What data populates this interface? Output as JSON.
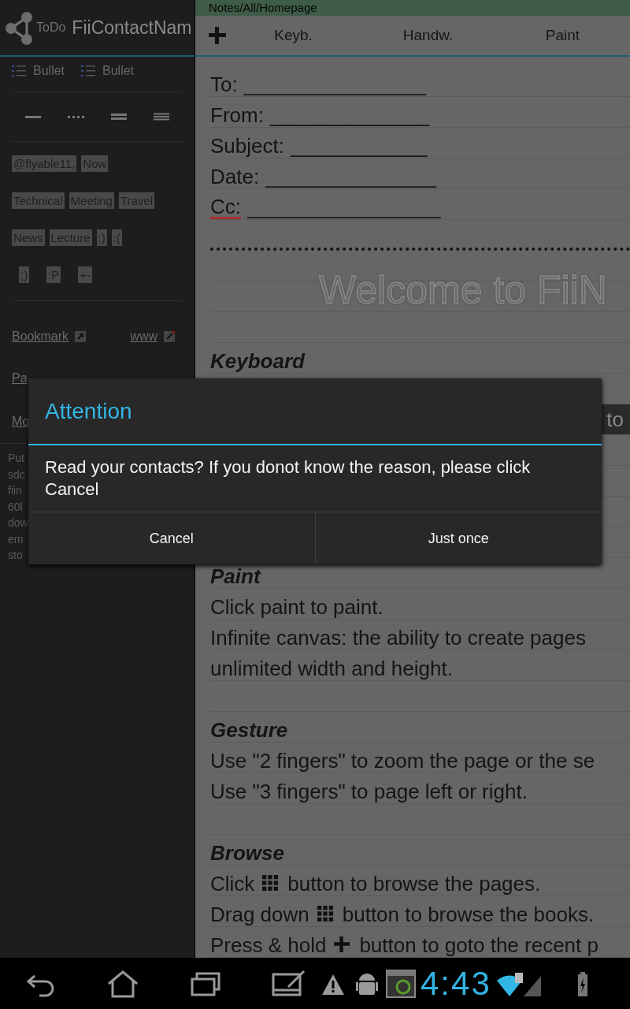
{
  "sidebar": {
    "header": {
      "todo": "ToDo",
      "title": "FiiContactNam"
    },
    "bullets": [
      "Bullet",
      "Bullet"
    ],
    "tag_rows": [
      [
        "@flyable11,",
        "Now"
      ],
      [
        "Technical",
        "Meeting",
        "Travel"
      ],
      [
        "News",
        "Lecture",
        ":)",
        ":("
      ],
      [
        ";)",
        ":P",
        "+-"
      ]
    ],
    "links": [
      "Bookmark",
      "www"
    ],
    "partial_links": [
      "Pa",
      "Mo"
    ],
    "note_lines": [
      "Put",
      "sdc",
      "fiin",
      "60l",
      "dow",
      "em",
      "sto"
    ]
  },
  "breadcrumb": "Notes/All/Homepage",
  "toolbar": {
    "modes": [
      "Keyb.",
      "Handw.",
      "Paint"
    ]
  },
  "note": {
    "lines": [
      {
        "kind": "field",
        "label": "To:",
        "blank": "________________"
      },
      {
        "kind": "field",
        "label": "From:",
        "blank": "______________"
      },
      {
        "kind": "field",
        "label": "Subject:",
        "blank": "____________"
      },
      {
        "kind": "field",
        "label": "Date:",
        "blank": "_______________"
      },
      {
        "kind": "field",
        "label": "Cc:",
        "blank": "_________________",
        "misspelled": true
      },
      {
        "kind": "dotted"
      },
      {
        "kind": "blank"
      },
      {
        "kind": "title",
        "text": "Welcome to FiiN"
      },
      {
        "kind": "blank"
      },
      {
        "kind": "heading",
        "text": "Keyboard"
      },
      {
        "kind": "blank"
      },
      {
        "kind": "edge",
        "text": "to"
      },
      {
        "kind": "blank"
      },
      {
        "kind": "blank"
      },
      {
        "kind": "blank"
      },
      {
        "kind": "blank"
      },
      {
        "kind": "heading",
        "text": "Paint"
      },
      {
        "kind": "text",
        "text": "Click paint to paint."
      },
      {
        "kind": "text",
        "text": "Infinite canvas: the ability to create pages"
      },
      {
        "kind": "text",
        "text": "unlimited width and height."
      },
      {
        "kind": "blank"
      },
      {
        "kind": "heading",
        "text": "Gesture"
      },
      {
        "kind": "text",
        "text": "Use \"2 fingers\" to zoom the page or the se"
      },
      {
        "kind": "text",
        "text": "Use \"3 fingers\" to page left or right."
      },
      {
        "kind": "blank"
      },
      {
        "kind": "heading",
        "text": "Browse"
      },
      {
        "kind": "grid_icon_text",
        "before": "Click",
        "after": "button to browse the pages."
      },
      {
        "kind": "grid_icon_text",
        "before": "Drag down",
        "after": "button to browse the books."
      },
      {
        "kind": "plus_icon_text",
        "before": "Press & hold",
        "after": "button to goto the recent p"
      }
    ]
  },
  "dialog": {
    "title": "Attention",
    "message": "Read your contacts? If you donot know the reason, please click Cancel",
    "buttons": [
      "Cancel",
      "Just once"
    ]
  },
  "status_bar": {
    "time": "4:43"
  }
}
